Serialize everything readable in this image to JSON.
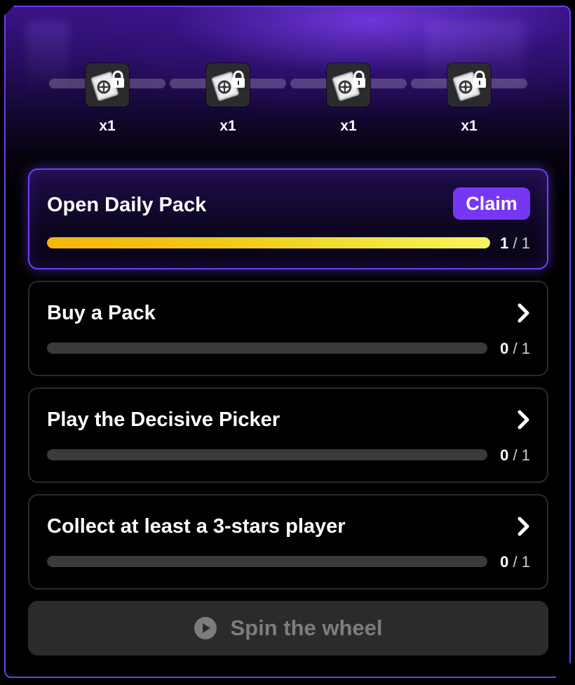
{
  "rewards": [
    {
      "icon": "locked-pack-icon",
      "quantity": "x1"
    },
    {
      "icon": "locked-pack-icon",
      "quantity": "x1"
    },
    {
      "icon": "locked-pack-icon",
      "quantity": "x1"
    },
    {
      "icon": "locked-pack-icon",
      "quantity": "x1"
    }
  ],
  "tasks": [
    {
      "title": "Open Daily Pack",
      "action_label": "Claim",
      "current": "1",
      "total": "/ 1",
      "progress": 1.0
    },
    {
      "title": "Buy a Pack",
      "action_icon": "chevron-right-icon",
      "current": "0",
      "total": "/ 1",
      "progress": 0
    },
    {
      "title": "Play the Decisive Picker",
      "action_icon": "chevron-right-icon",
      "current": "0",
      "total": "/ 1",
      "progress": 0
    },
    {
      "title": "Collect at least a 3-stars player",
      "action_icon": "chevron-right-icon",
      "current": "0",
      "total": "/ 1",
      "progress": 0
    }
  ],
  "spin_button": {
    "label": "Spin the wheel",
    "icon": "play-circle-icon",
    "enabled": false
  },
  "colors": {
    "accent": "#7637f5",
    "progress_start": "#f5b50d",
    "progress_end": "#f6f35e",
    "border_active": "#6c43f0"
  }
}
